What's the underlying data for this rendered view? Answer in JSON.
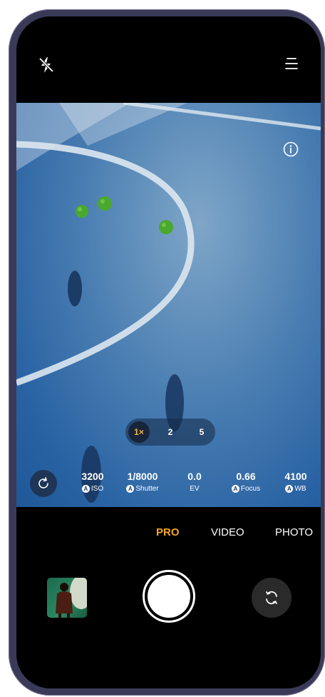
{
  "top_bar": {
    "flash_icon": "flash-off-icon",
    "menu_icon": "menu-icon"
  },
  "viewfinder": {
    "info_icon": "info-icon"
  },
  "zoom": {
    "options": [
      "1×",
      "2",
      "5"
    ],
    "selected": "1×"
  },
  "pro_settings": {
    "reset_icon": "reset-icon",
    "items": [
      {
        "value": "3200",
        "label": "ISO",
        "auto": true,
        "auto_badge": "A"
      },
      {
        "value": "1/8000",
        "label": "Shutter",
        "auto": true,
        "auto_badge": "A"
      },
      {
        "value": "0.0",
        "label": "EV",
        "auto": false
      },
      {
        "value": "0.66",
        "label": "Focus",
        "auto": true,
        "auto_badge": "A"
      },
      {
        "value": "4100",
        "label": "WB",
        "auto": true,
        "auto_badge": "A"
      }
    ]
  },
  "modes": {
    "items": [
      "PRO",
      "VIDEO",
      "PHOTO"
    ],
    "active": "PRO",
    "active_color": "#f5a623"
  },
  "bottom_bar": {
    "gallery_icon": "gallery-thumbnail",
    "shutter_icon": "shutter-button",
    "switch_icon": "camera-switch-icon"
  }
}
